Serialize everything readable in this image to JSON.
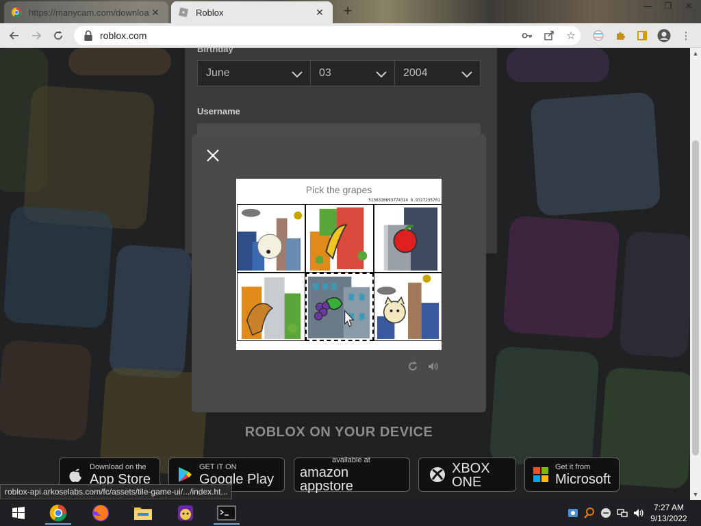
{
  "browser": {
    "tabs": [
      {
        "title": "https://manycam.com/downloa...",
        "active": false
      },
      {
        "title": "Roblox",
        "active": true
      }
    ],
    "url": "roblox.com",
    "status_url": "roblox-api.arkoselabs.com/fc/assets/tile-game-ui/.../index.ht..."
  },
  "form": {
    "birthday_label": "Birthday",
    "month": "June",
    "day": "03",
    "year": "2004",
    "username_label": "Username"
  },
  "captcha": {
    "prompt": "Pick the grapes",
    "code": "5136320693774314 9.9327235701",
    "tiles": [
      {
        "item": "sheep",
        "selected": false
      },
      {
        "item": "banana",
        "selected": false
      },
      {
        "item": "apple",
        "selected": false
      },
      {
        "item": "kangaroo",
        "selected": false
      },
      {
        "item": "grapes",
        "selected": true
      },
      {
        "item": "cat",
        "selected": false
      }
    ]
  },
  "devices": {
    "title": "ROBLOX ON YOUR DEVICE",
    "stores": [
      {
        "small": "Download on the",
        "big": "App Store"
      },
      {
        "small": "GET IT ON",
        "big": "Google Play"
      },
      {
        "small": "available at",
        "big": "amazon appstore"
      },
      {
        "small": "",
        "big": "XBOX ONE"
      },
      {
        "small": "Get it from",
        "big": "Microsoft"
      }
    ]
  },
  "taskbar": {
    "time": "7:27 AM",
    "date": "9/13/2022"
  }
}
